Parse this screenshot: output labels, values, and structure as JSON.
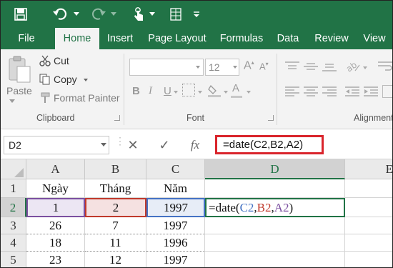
{
  "colors": {
    "excel_green": "#217346",
    "ref_blue": "#4472c4",
    "ref_red": "#c0392b",
    "ref_purple": "#7b4fa0",
    "highlight_red": "#d9242b"
  },
  "qat": {
    "icons": [
      "save-icon",
      "undo-icon",
      "undo-dropdown-icon",
      "redo-icon",
      "redo-dropdown-icon",
      "touch-mode-icon",
      "form-icon",
      "customize-qat-icon"
    ]
  },
  "tabs": [
    "File",
    "Home",
    "Insert",
    "Page Layout",
    "Formulas",
    "Data",
    "Review",
    "View"
  ],
  "ribbon": {
    "clipboard": {
      "paste": "Paste",
      "cut": "Cut",
      "copy": "Copy",
      "format_painter": "Format Painter",
      "group_label": "Clipboard"
    },
    "font": {
      "font_size": "12",
      "group_label": "Font",
      "bold": "B",
      "italic": "I",
      "underline": "U"
    },
    "alignment": {
      "group_label": "Alignment"
    }
  },
  "formula_bar": {
    "name_box": "D2",
    "cancel": "✕",
    "enter": "✓",
    "fx": "fx",
    "formula": "=date(C2,B2,A2)"
  },
  "sheet": {
    "columns": [
      "A",
      "B",
      "C",
      "D",
      "E"
    ],
    "rows": [
      "1",
      "2",
      "3",
      "4",
      "5"
    ],
    "header_row": [
      "Ngày",
      "Tháng",
      "Năm"
    ],
    "data": [
      [
        "1",
        "2",
        "1997"
      ],
      [
        "26",
        "7",
        "1997"
      ],
      [
        "18",
        "11",
        "1996"
      ],
      [
        "23",
        "12",
        "1997"
      ]
    ],
    "editing_cell": {
      "prefix": "=date(",
      "ref1": "C2",
      "comma1": ",",
      "ref2": "B2",
      "comma2": ",",
      "ref3": "A2",
      "suffix": ")"
    }
  }
}
